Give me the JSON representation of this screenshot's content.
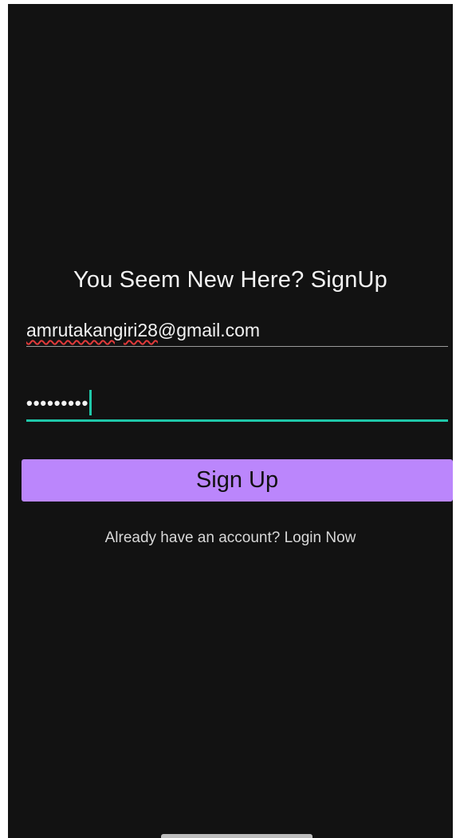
{
  "header": {
    "title": "You Seem New Here? SignUp"
  },
  "form": {
    "email": {
      "value_misspelled_part": "amrutakangiri28",
      "value_rest": "@gmail.com"
    },
    "password": {
      "masked_value": "•••••••••"
    },
    "submit_label": "Sign Up",
    "login_link": "Already have an account? Login Now"
  },
  "colors": {
    "background": "#121212",
    "accent": "#1fc7a9",
    "button": "#bb86fc",
    "spellcheck": "#e03a3a"
  }
}
